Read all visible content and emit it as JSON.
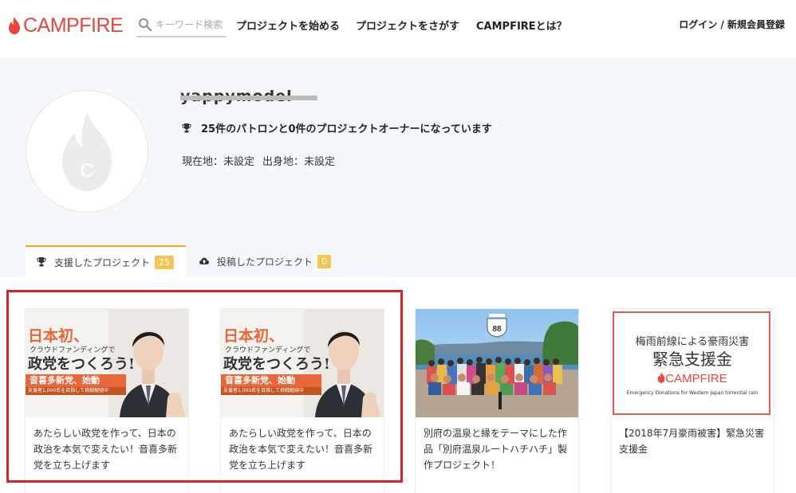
{
  "header": {
    "logo_text": "CAMPFIRE",
    "search_placeholder": "キーワード検索",
    "nav": [
      "プロジェクトを始める",
      "プロジェクトをさがす",
      "CAMPFIREとは？"
    ],
    "login": "ログイン / 新規会員登録"
  },
  "profile": {
    "username": "yappymodel",
    "avatar_letter": "C",
    "summary": "25件のパトロンと0件のプロジェクトオーナーになっています",
    "current_location": "現在地：未設定",
    "birthplace": "出身地：未設定"
  },
  "tabs": [
    {
      "label": "支援したプロジェクト",
      "count": "25"
    },
    {
      "label": "投稿したプロジェクト",
      "count": "0"
    }
  ],
  "cards": [
    {
      "title": "あたらしい政党を作って、日本の政治を本気で変えたい！音喜多新党を立ち上げます",
      "banner": {
        "line1": "日本初、",
        "line2": "クラウドファンディングで",
        "line3": "政党をつくろう!",
        "bar": "音喜多新党、始動",
        "bar2": "支援者1,000名を目指して挑戦継続中"
      }
    },
    {
      "title": "あたらしい政党を作って、日本の政治を本気で変えたい！音喜多新党を立ち上げます",
      "banner": {
        "line1": "日本初、",
        "line2": "クラウドファンディングで",
        "line3": "政党をつくろう!",
        "bar": "音喜多新党、始動",
        "bar2": "支援者1,000名を目指して挑戦継続中"
      }
    },
    {
      "title": "別府の温泉と縁をテーマにした作品「別府温泉ルートハチハチ」製作プロジェクト！",
      "banner": {
        "badge": "88"
      }
    },
    {
      "title": "【2018年7月豪雨被害】緊急災害支援金",
      "banner": {
        "line1": "梅雨前線による豪雨災害",
        "line2": "緊急支援金",
        "logo": "CAMPFIRE",
        "line3": "Emergency Donations for Western Japan torrential rain"
      }
    }
  ],
  "colors": {
    "brand": "#e8463b",
    "tab_accent": "#f5a623",
    "count_badge": "#f5c451",
    "highlight": "#d9202c"
  }
}
